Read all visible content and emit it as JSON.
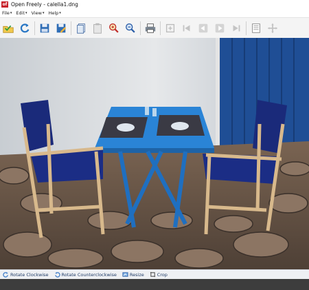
{
  "window": {
    "app_icon_text": "of",
    "title": "Open Freely - calella1.dng"
  },
  "menu": [
    {
      "label": "File"
    },
    {
      "label": "Edit"
    },
    {
      "label": "View"
    },
    {
      "label": "Help"
    }
  ],
  "toolbar": {
    "icons": [
      "open-folder-icon",
      "refresh-icon",
      "save-icon",
      "save-as-icon",
      "copy-icon",
      "paste-icon",
      "zoom-in-icon",
      "zoom-out-icon",
      "print-icon",
      "fit-icon",
      "first-page-icon",
      "previous-page-icon",
      "next-page-icon",
      "last-page-icon",
      "page-icon",
      "pan-icon"
    ]
  },
  "statusbar": {
    "rotate_cw": "Rotate Clockwise",
    "rotate_ccw": "Rotate Counterclockwise",
    "resize": "Resize",
    "crop": "Crop"
  }
}
